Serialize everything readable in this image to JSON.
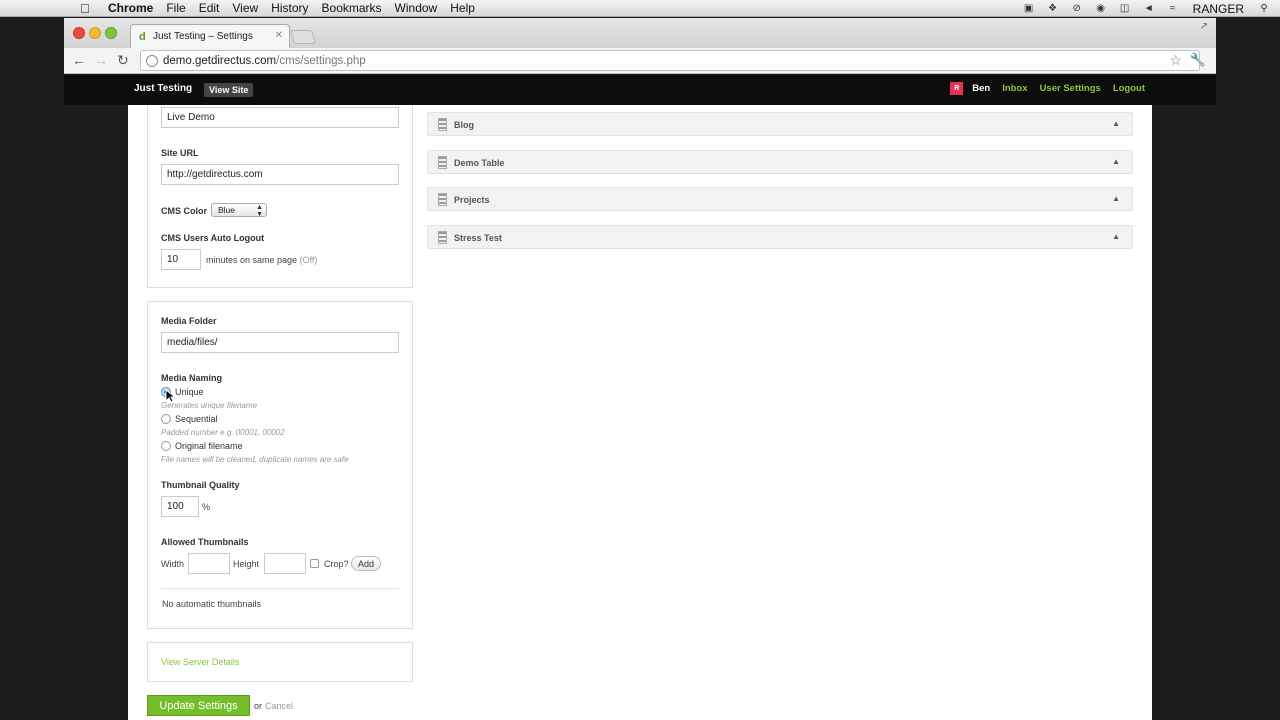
{
  "mac_menu": {
    "apple": "",
    "app": "Chrome",
    "items": [
      "File",
      "Edit",
      "View",
      "History",
      "Bookmarks",
      "Window",
      "Help"
    ],
    "user": "RANGER"
  },
  "browser": {
    "tab_title": "Just Testing – Settings",
    "url_host": "demo.getdirectus.com",
    "url_path": "/cms/settings.php"
  },
  "header": {
    "brand": "Just Testing",
    "view_site": "View Site",
    "avatar_letter": "R",
    "user_name": "Ben",
    "inbox": "Inbox",
    "user_settings": "User Settings",
    "logout": "Logout"
  },
  "settings": {
    "site_name_value": "Live Demo",
    "site_url_label": "Site URL",
    "site_url_value": "http://getdirectus.com",
    "cms_color_label": "CMS Color",
    "cms_color_value": "Blue",
    "auto_logout_label": "CMS Users Auto Logout",
    "auto_logout_value": "10",
    "auto_logout_suffix": "minutes on same page",
    "auto_logout_off": "(Off)"
  },
  "media": {
    "folder_label": "Media Folder",
    "folder_value": "media/files/",
    "naming_label": "Media Naming",
    "options": [
      {
        "label": "Unique",
        "hint": "Generates unique filename",
        "selected": true
      },
      {
        "label": "Sequential",
        "hint": "Padded number e.g. 00001, 00002",
        "selected": false
      },
      {
        "label": "Original filename",
        "hint": "File names will be cleaned, duplicate names are safe",
        "selected": false
      }
    ],
    "thumb_quality_label": "Thumbnail Quality",
    "thumb_quality_value": "100",
    "thumb_quality_unit": "%",
    "allowed_thumbs_label": "Allowed Thumbnails",
    "width_label": "Width",
    "height_label": "Height",
    "crop_label": "Crop?",
    "add_label": "Add",
    "no_thumbs": "No automatic thumbnails"
  },
  "server": {
    "details_link": "View Server Details"
  },
  "actions": {
    "update": "Update Settings",
    "or": "or",
    "cancel": "Cancel"
  },
  "tables": [
    "Blog",
    "Demo Table",
    "Projects",
    "Stress Test"
  ],
  "colors": {
    "accent_green": "#76bd2b",
    "link_green": "#8bc43f",
    "avatar_red": "#e03355"
  }
}
